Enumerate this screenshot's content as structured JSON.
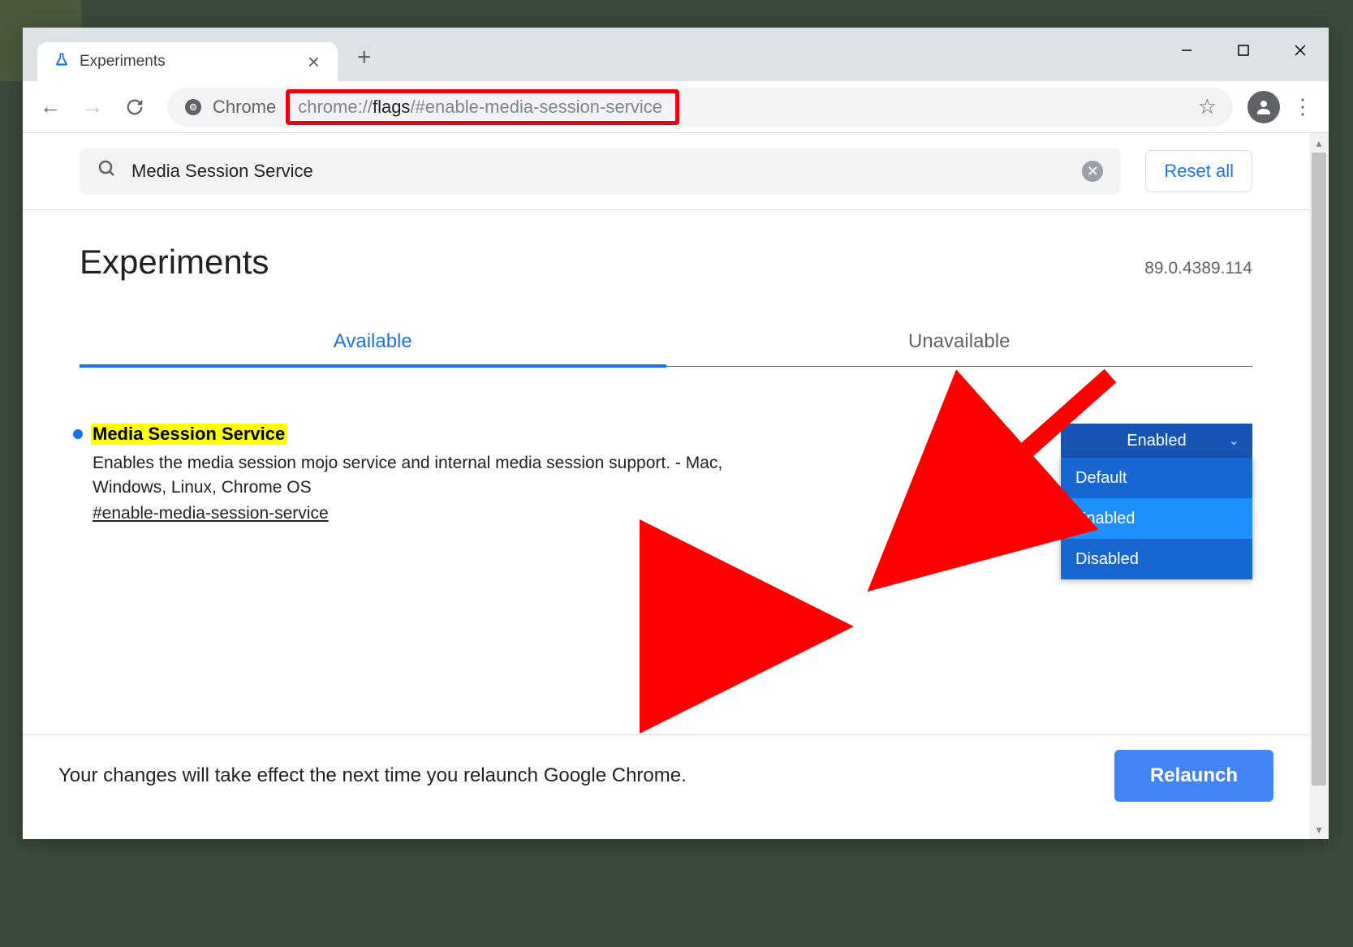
{
  "window": {
    "tab_title": "Experiments",
    "url_product_label": "Chrome",
    "url_plain": "chrome://",
    "url_bold": "flags",
    "url_rest": "/#enable-media-session-service"
  },
  "search": {
    "value": "Media Session Service",
    "reset_label": "Reset all"
  },
  "header": {
    "title": "Experiments",
    "version": "89.0.4389.114"
  },
  "tabs": {
    "available": "Available",
    "unavailable": "Unavailable"
  },
  "flag": {
    "title": "Media Session Service",
    "description": "Enables the media session mojo service and internal media session support. - Mac, Windows, Linux, Chrome OS",
    "anchor": "#enable-media-session-service",
    "selected": "Enabled",
    "options": {
      "default": "Default",
      "enabled": "Enabled",
      "disabled": "Disabled"
    }
  },
  "relaunch": {
    "message": "Your changes will take effect the next time you relaunch Google Chrome.",
    "button": "Relaunch"
  }
}
